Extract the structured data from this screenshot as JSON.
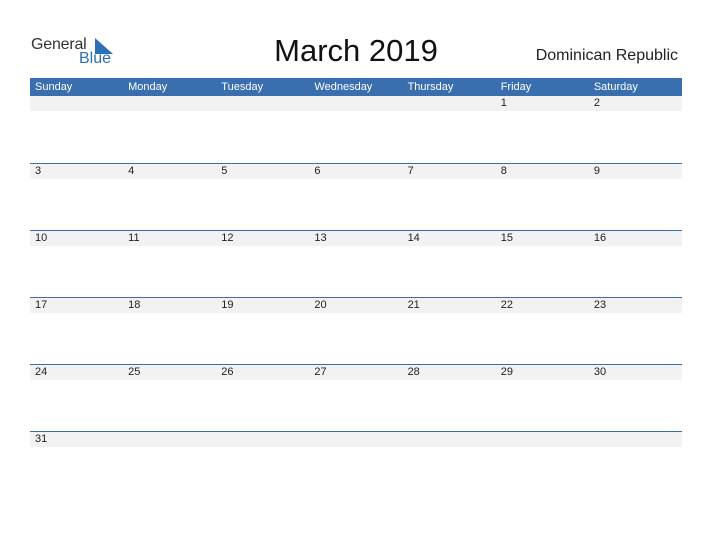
{
  "logo": {
    "general": "General",
    "blue": "Blue"
  },
  "title": "March 2019",
  "country": "Dominican Republic",
  "weekdays": [
    "Sunday",
    "Monday",
    "Tuesday",
    "Wednesday",
    "Thursday",
    "Friday",
    "Saturday"
  ],
  "weeks": [
    [
      "",
      "",
      "",
      "",
      "",
      "1",
      "2"
    ],
    [
      "3",
      "4",
      "5",
      "6",
      "7",
      "8",
      "9"
    ],
    [
      "10",
      "11",
      "12",
      "13",
      "14",
      "15",
      "16"
    ],
    [
      "17",
      "18",
      "19",
      "20",
      "21",
      "22",
      "23"
    ],
    [
      "24",
      "25",
      "26",
      "27",
      "28",
      "29",
      "30"
    ],
    [
      "31",
      "",
      "",
      "",
      "",
      "",
      ""
    ]
  ],
  "colors": {
    "accent": "#3a6faf",
    "logo_blue": "#2f6fb3",
    "cell_bar": "#f2f2f2"
  }
}
